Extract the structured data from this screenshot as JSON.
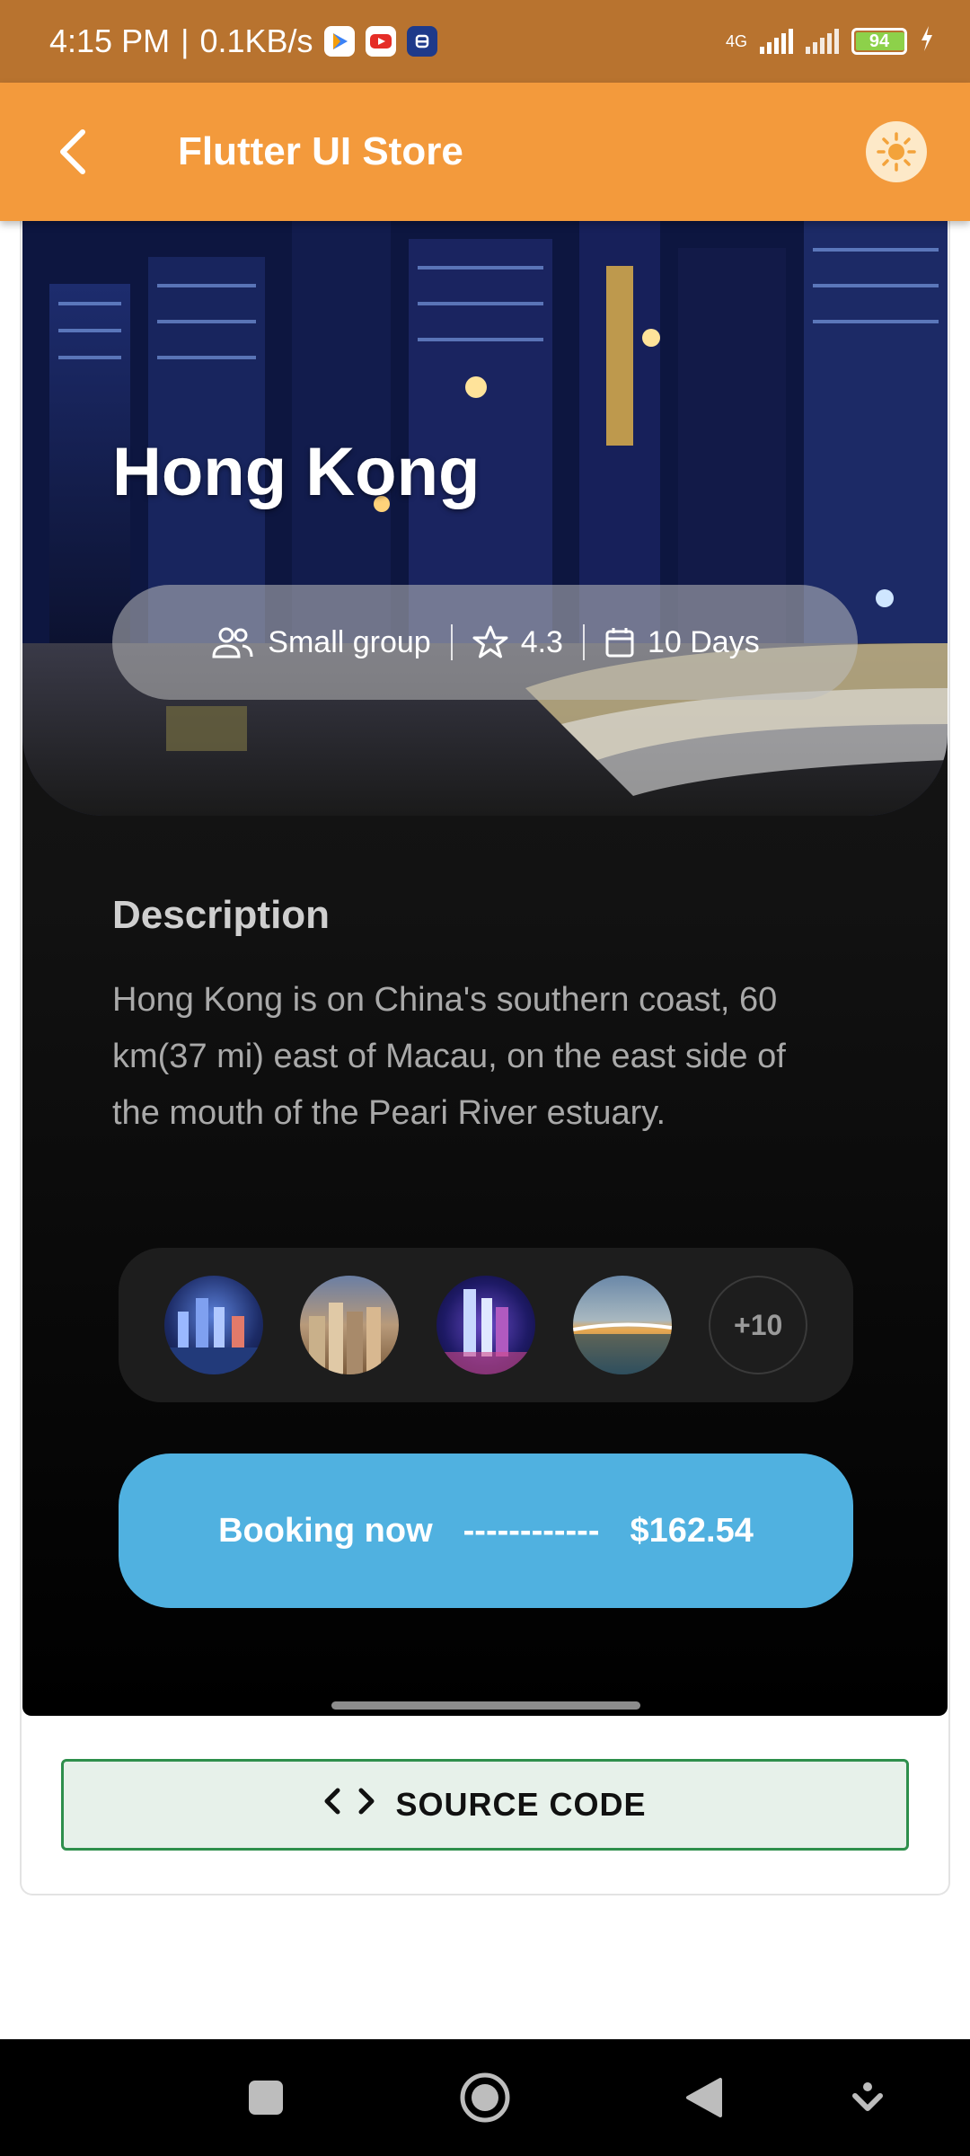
{
  "status_bar": {
    "time": "4:15 PM",
    "network_speed": "0.1KB/s",
    "network_type": "4G",
    "battery": "94",
    "battery_level": 0.94,
    "icons": [
      "play-store-icon",
      "youtube-icon",
      "app-notification-icon",
      "signal-icon",
      "charging-icon"
    ]
  },
  "app_bar": {
    "title": "Flutter UI Store",
    "back_icon": "chevron-left-icon",
    "theme_icon": "sun-icon"
  },
  "destination": {
    "name": "Hong Kong",
    "group": "Small group",
    "rating": "4.3",
    "duration": "10 Days"
  },
  "description": {
    "title": "Description",
    "text": "Hong Kong is on China's southern coast, 60 km(37 mi) east of Macau, on the east side of the mouth of the Peari River estuary."
  },
  "gallery": {
    "more_count": "+10"
  },
  "booking": {
    "label": "Booking now",
    "dashes": "------------",
    "price": "$162.54"
  },
  "source_code": {
    "icon": "</>",
    "label": "SOURCE CODE"
  },
  "colors": {
    "status_bar": "#b8732f",
    "app_bar": "#f39a3c",
    "booking_button": "#50b1e0",
    "source_button_border": "#2e8f4c"
  }
}
